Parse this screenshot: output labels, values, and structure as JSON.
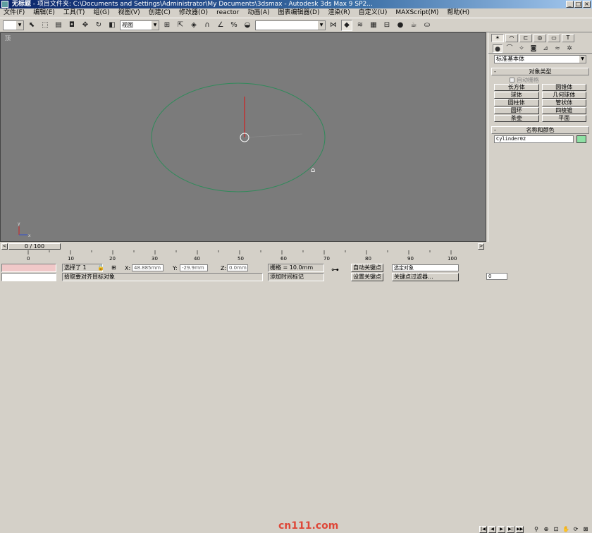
{
  "titlebar": {
    "title": "无标题",
    "project": "- 项目文件夹: C:\\Documents and Settings\\Administrator\\My Documents\\3dsmax",
    "app": "- Autodesk 3ds Max 9 SP2..."
  },
  "menu": [
    "文件(F)",
    "编辑(E)",
    "工具(T)",
    "组(G)",
    "视图(V)",
    "创建(C)",
    "修改器(O)",
    "reactor",
    "动画(A)",
    "图表编辑器(D)",
    "渲染(R)",
    "自定义(U)",
    "MAXScript(M)",
    "帮助(H)"
  ],
  "toolbar": {
    "view_select": "视图",
    "icons": [
      "undo-icon",
      "select-icon",
      "region-select-icon",
      "select-by-name-icon",
      "move-icon",
      "rotate-icon",
      "scale-icon",
      "reference-coord-icon",
      "pivot-icon",
      "link-icon",
      "snap-icon",
      "angle-snap-icon",
      "percent-snap-icon",
      "spinner-snap-icon",
      "named-selection-icon",
      "mirror-icon",
      "align-icon",
      "layer-icon",
      "curve-editor-icon",
      "schematic-icon",
      "material-editor-icon",
      "render-scene-icon",
      "quick-render-icon"
    ]
  },
  "viewport": {
    "label": "顶",
    "bg_color": "#7b7b7b",
    "circle_color": "#2f8a5a"
  },
  "cmdpanel": {
    "tabs": [
      "create-tab",
      "modify-tab",
      "hierarchy-tab",
      "motion-tab",
      "display-tab",
      "utilities-tab"
    ],
    "sub_icons": [
      "geometry-icon",
      "shapes-icon",
      "lights-icon",
      "cameras-icon",
      "helpers-icon",
      "spacewarps-icon",
      "systems-icon"
    ],
    "category": "标准基本体",
    "object_type_title": "对象类型",
    "autogrid": "自动栅格",
    "objects": [
      "长方体",
      "圆锥体",
      "球体",
      "几何球体",
      "圆柱体",
      "管状体",
      "圆环",
      "四棱锥",
      "茶壶",
      "平面"
    ],
    "name_color_title": "名称和颜色",
    "object_name": "Cylinder02",
    "object_color": "#8ee0a4"
  },
  "timeline": {
    "frame_display": "0 / 100",
    "ticks": [
      "0",
      "10",
      "20",
      "30",
      "40",
      "50",
      "60",
      "70",
      "80",
      "90",
      "100"
    ]
  },
  "status": {
    "selected": "选择了 1",
    "x_label": "X:",
    "x_value": "48.885mm",
    "y_label": "Y:",
    "y_value": "-29.9mm",
    "z_label": "Z:",
    "z_value": "0.0mm",
    "grid": "栅格 = 10.0mm",
    "auto_key": "自动关键点",
    "set_key": "设置关键点",
    "selection_filter": "选定对象",
    "key_filter": "关键点过滤器...",
    "prompt": "拾取要对齐目标对象",
    "add_time_tag": "添加时间标记",
    "frame": "0",
    "watermark": "cn111.com"
  }
}
